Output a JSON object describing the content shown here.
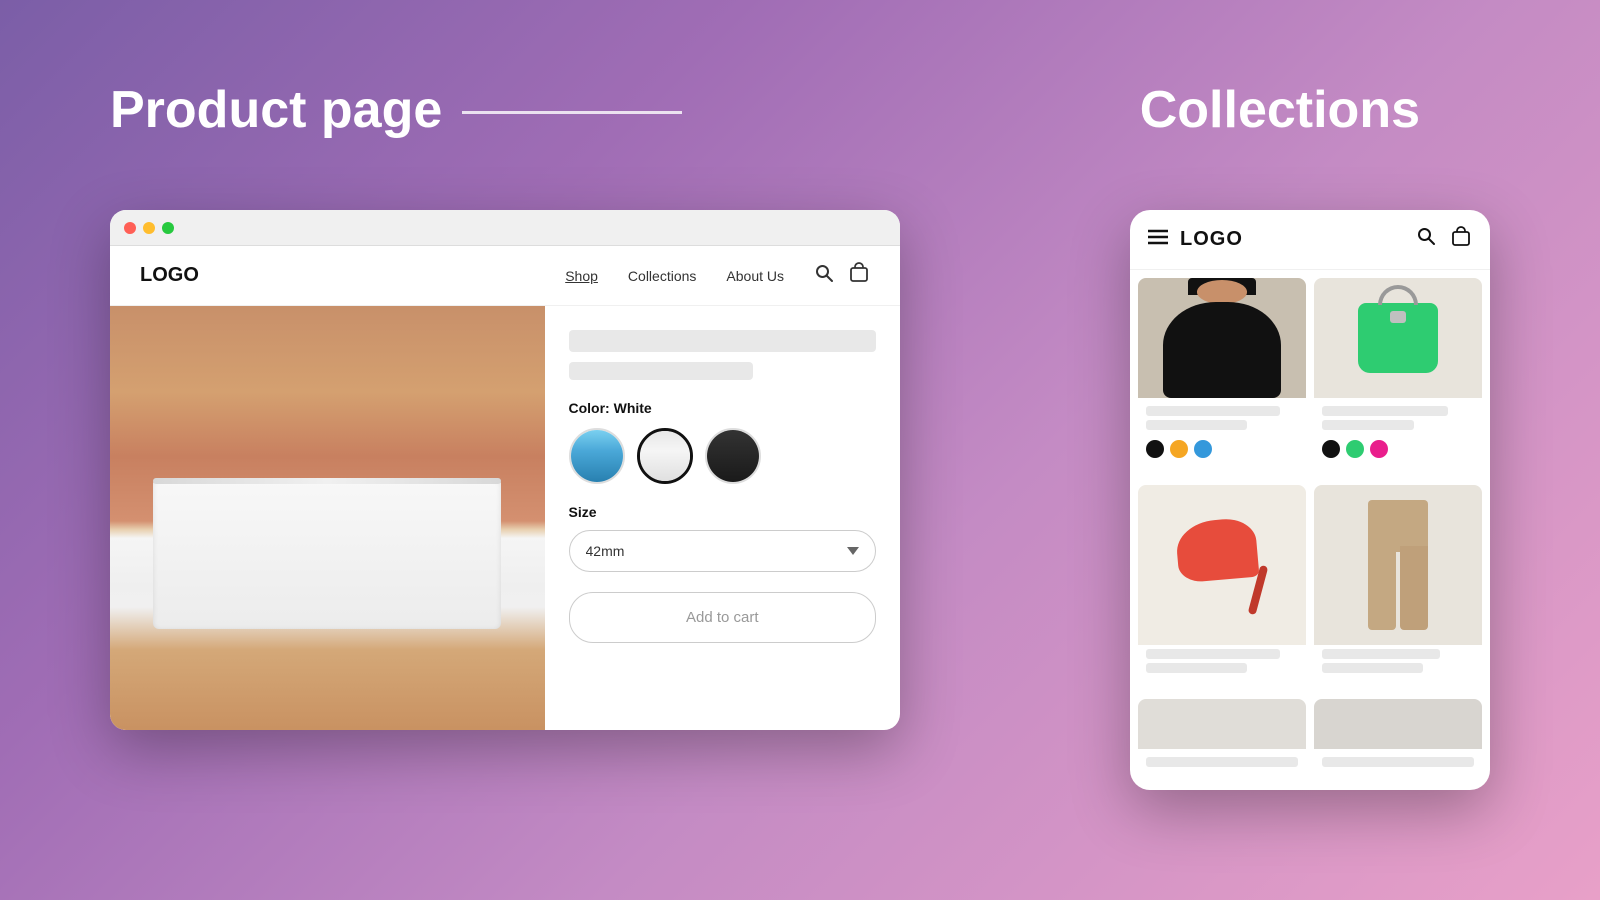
{
  "page": {
    "background_gradient": "linear-gradient(135deg, #7b5ea7, #c48bc4, #e8a0c8)"
  },
  "product_section": {
    "title": "Product page",
    "line_decoration": true,
    "browser": {
      "dots": [
        "red",
        "yellow",
        "green"
      ],
      "nav": {
        "logo": "LOGO",
        "links": [
          {
            "label": "Shop",
            "active": true
          },
          {
            "label": "Collections",
            "active": false
          },
          {
            "label": "About Us",
            "active": false
          }
        ]
      },
      "product": {
        "color_label": "Color: White",
        "size_label": "Size",
        "size_value": "42mm",
        "add_to_cart_label": "Add to cart",
        "swatches": [
          {
            "color": "blue",
            "label": "Blue"
          },
          {
            "color": "white",
            "label": "White"
          },
          {
            "color": "black",
            "label": "Black"
          }
        ]
      }
    }
  },
  "collections_section": {
    "title": "Collections",
    "mobile": {
      "logo": "LOGO",
      "menu_icon": "☰",
      "items": [
        {
          "type": "black-sweater",
          "name_bar_width": "80%",
          "price_bar_width": "60%",
          "colors": [
            "#111111",
            "#f5a623",
            "#3498db"
          ]
        },
        {
          "type": "green-bag",
          "name_bar_width": "75%",
          "price_bar_width": "55%",
          "colors": [
            "#111111",
            "#2ecc71",
            "#e91e8c"
          ]
        },
        {
          "type": "red-heels",
          "name_bar_width": "80%",
          "price_bar_width": "60%",
          "colors": []
        },
        {
          "type": "beige-pants",
          "name_bar_width": "70%",
          "price_bar_width": "50%",
          "colors": []
        },
        {
          "type": "placeholder-1",
          "colors": []
        },
        {
          "type": "placeholder-2",
          "colors": []
        }
      ]
    }
  }
}
